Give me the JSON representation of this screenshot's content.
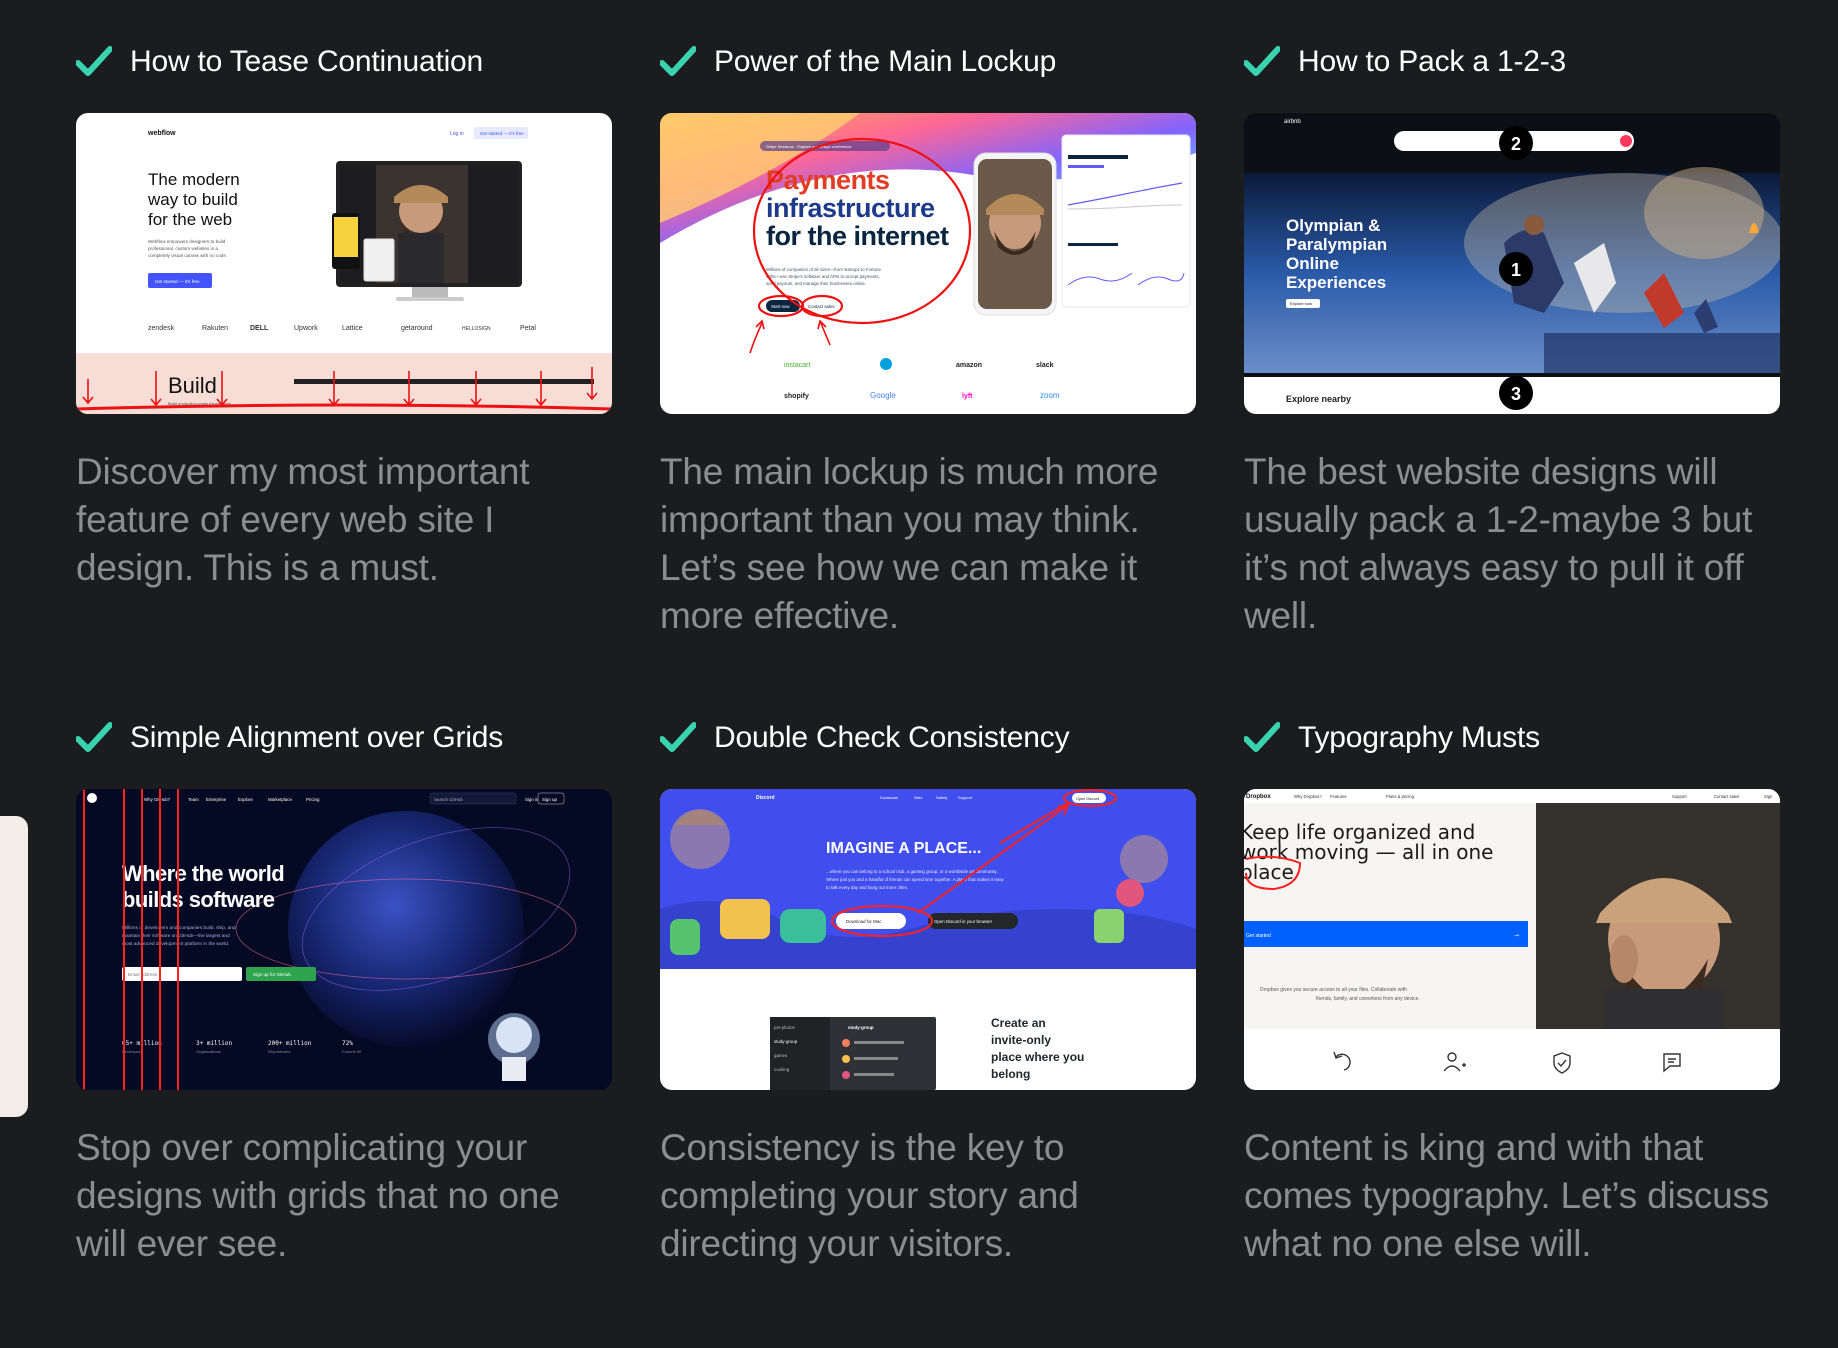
{
  "accent_color": "#39d3b0",
  "check_icon": "checkmark-icon",
  "cards": [
    {
      "title": "How to Tease Continuation",
      "description": "Discover my most important feature of every web site I design. This is a must.",
      "thumb": {
        "brand": "webflow",
        "nav_login": "Log in",
        "nav_cta": "Get started — it's free",
        "headline_1": "The modern",
        "headline_2": "way to build",
        "headline_3": "for the web",
        "body": "Webflow empowers designers to build professional, custom websites in a completely visual canvas with no code.",
        "cta": "Get started — it's free",
        "logos": [
          "zendesk",
          "Rakuten",
          "DELL",
          "Upwork",
          "Lattice",
          "getaround",
          "HELLOSIGN",
          "Petal"
        ],
        "footer_title": "Build",
        "footer_sub": "Build production-ready experiences"
      }
    },
    {
      "title": "Power of the Main Lockup",
      "description": "The main lockup is much more important than you may think. Let’s see how we can make it more effective.",
      "thumb": {
        "badge": "Stripe Sessions · Explore our design conference",
        "headline_1": "Payments",
        "headline_2": "infrastructure",
        "headline_3": "for the internet",
        "body": "Millions of companies of all sizes—from startups to Fortune 500s—use Stripe's software and APIs to accept payments, send payouts, and manage their businesses online.",
        "cta_primary": "Start now",
        "cta_secondary": "Contact sales",
        "logos": [
          "instacart",
          "salesforce",
          "amazon",
          "slack",
          "shopify",
          "Google",
          "lyft",
          "zoom"
        ]
      }
    },
    {
      "title": "How to Pack a 1-2-3",
      "description": "The best website designs will usually pack a 1-2-maybe 3 but it’s not always easy to pull it off well.",
      "thumb": {
        "brand": "airbnb",
        "headline_1": "Olympian &",
        "headline_2": "Paralympian",
        "headline_3": "Online",
        "headline_4": "Experiences",
        "cta": "Explore now",
        "footer": "Explore nearby",
        "markers": [
          "1",
          "2",
          "3"
        ]
      }
    },
    {
      "title": "Simple Alignment over Grids",
      "description": "Stop over complicating your designs with grids that no one will ever see.",
      "thumb": {
        "brand": "Why GitHub?",
        "nav": [
          "Team",
          "Enterprise",
          "Explore",
          "Marketplace",
          "Pricing"
        ],
        "search": "Search GitHub",
        "sign_in": "Sign in",
        "sign_up": "Sign up",
        "headline_1": "Where the world",
        "headline_2": "builds software",
        "body": "Millions of developers and companies build, ship, and maintain their software on GitHub—the largest and most advanced development platform in the world.",
        "email_placeholder": "Email address",
        "cta": "Sign up for GitHub",
        "stats": [
          {
            "value": "65+ million",
            "label": "Developers"
          },
          {
            "value": "3+ million",
            "label": "Organizations"
          },
          {
            "value": "200+ million",
            "label": "Repositories"
          },
          {
            "value": "72%",
            "label": "Fortune 50"
          }
        ]
      }
    },
    {
      "title": "Double Check Consistency",
      "description": "Consistency is the key to completing your story and directing your visitors.",
      "thumb": {
        "brand": "Discord",
        "nav": [
          "Download",
          "Nitro",
          "Safety",
          "Support"
        ],
        "nav_cta": "Open Discord",
        "headline": "IMAGINE A PLACE...",
        "body": "...where you can belong to a school club, a gaming group, or a worldwide art community. Where just you and a handful of friends can spend time together. A place that makes it easy to talk every day and hang out more often.",
        "cta_primary": "Download for Mac",
        "cta_secondary": "Open Discord in your browser",
        "channels": [
          "pet-photos",
          "study-group",
          "games",
          "cooking"
        ],
        "server": "study-group",
        "feature_1": "Create an",
        "feature_2": "invite-only",
        "feature_3": "place where you",
        "feature_4": "belong"
      }
    },
    {
      "title": "Typography Musts",
      "description": "Content is king and with that comes typography. Let’s discuss what no one else will.",
      "thumb": {
        "brand": "Dropbox",
        "nav": [
          "Why Dropbox?",
          "Features",
          "Plans & pricing"
        ],
        "nav_right": [
          "Support",
          "Contact sales",
          "Sign"
        ],
        "headline_1": "Keep life organized and",
        "headline_2": "work moving — all in one",
        "headline_3": "place",
        "cta": "Get started",
        "body_1": "Dropbox gives you secure access to all your files. Collaborate with",
        "body_2": "friends, family, and coworkers from any device."
      }
    }
  ]
}
